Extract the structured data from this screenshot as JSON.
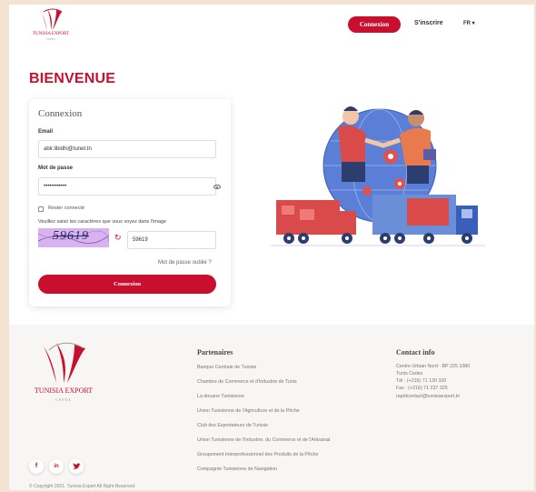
{
  "header": {
    "logo_text": "TUNISIA EXPORT",
    "logo_sub": "CEPEX",
    "login_button": "Connexion",
    "signup_link": "S'inscrire",
    "language": "FR ▾"
  },
  "page_title": "BIENVENUE",
  "login_card": {
    "title": "Connexion",
    "email_label": "Email",
    "email_value": "abir.libidhi@tunet.tn",
    "password_label": "Mot de passe",
    "password_value": "••••••••••••",
    "remember_label": "Rester connecté",
    "captcha_label": "Veuillez saisir les caractères que vous voyez dans l'image",
    "captcha_image_text": "59619",
    "captcha_value": "59619",
    "forgot_link": "Mot de passe oublié ?",
    "submit_label": "Connexion"
  },
  "footer": {
    "logo_text": "TUNISIA EXPORT",
    "logo_sub": "CEPEX",
    "partners_title": "Partenaires",
    "partners": [
      "Banque Centrale de Tunisie",
      "Chambre de Commerce et d'Industrie de Tunis",
      "La douane Tunisienne",
      "Union Tunisienne de l'Agriculture et de la Pêche",
      "Club des Exportateurs de Tunisie",
      "Union Tunisienne de l'Industrie, du Commerce et de l'Artisanat",
      "Groupement Interprofessionnel des Produits de la Pêche",
      "Compagnie Tunisienne de Navigation"
    ],
    "contact_title": "Contact info",
    "contact": [
      "Centre Urbain Nord - BP 225 1080",
      "Tunis Cedex",
      "Tél : (+216) 71 130 320",
      "Fax : (+216) 71 237 325",
      "rapidcontact@tunisiaexport.tn"
    ],
    "social": {
      "facebook": "f",
      "linkedin": "in",
      "twitter": "🐦"
    },
    "copyright": "© Copyright 2021. Tunisia Export All Right Reserved."
  },
  "colors": {
    "brand": "#c8102e",
    "background": "#f3e3d0"
  },
  "icons": [
    "tunisia-export-logo",
    "eye-icon",
    "refresh-icon",
    "facebook-icon",
    "linkedin-icon",
    "twitter-icon"
  ]
}
